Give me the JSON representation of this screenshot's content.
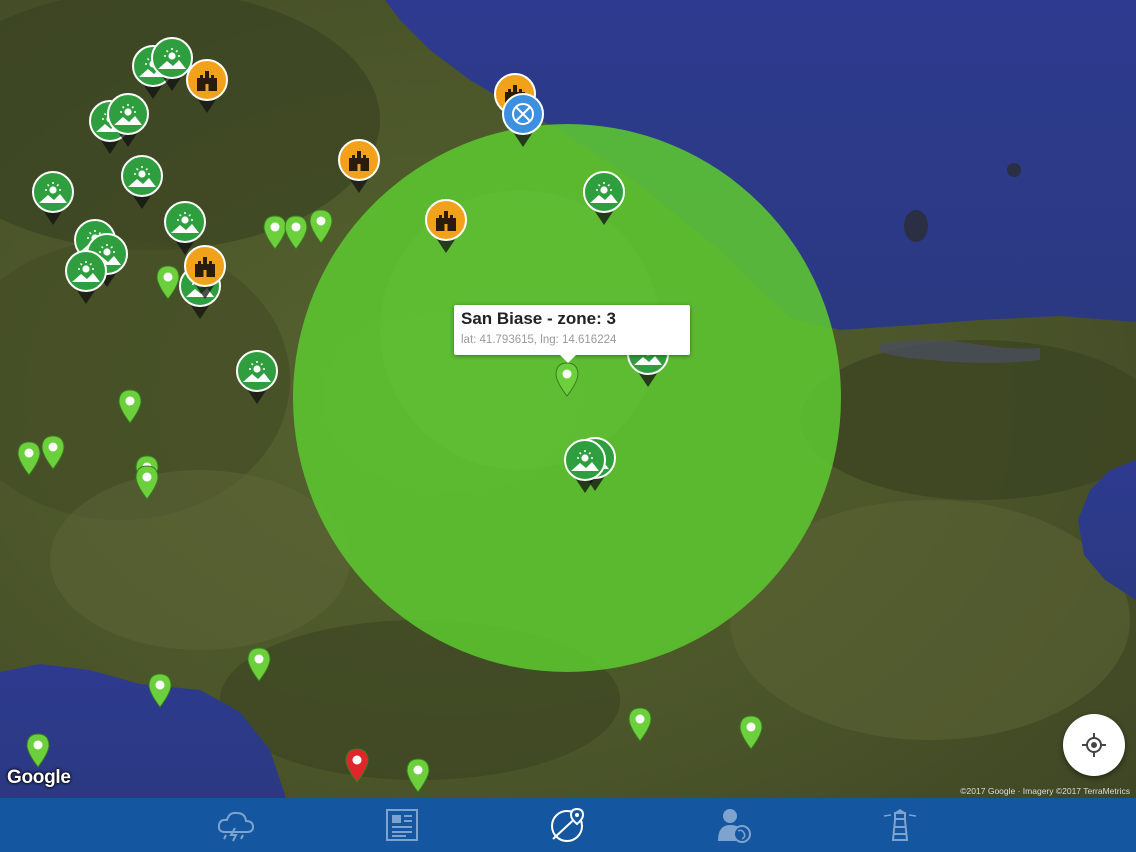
{
  "map": {
    "callout": {
      "title": "San Biase - zone: 3",
      "subtitle": "lat: 41.793615, lng: 14.616224"
    },
    "zone_circle_color": "#5cc630",
    "google_logo": "Google",
    "attribution": "©2017 Google · Imagery ©2017 TerraMetrics",
    "locate_button_icon": "crosshair-icon",
    "marker_colors": {
      "weather": "#2e9e3e",
      "castle": "#f2a21a",
      "poi": "#6ccf3c",
      "alert": "#e0262a",
      "drone": "#3d8fe0"
    }
  },
  "tabbar": {
    "tabs": [
      {
        "icon": "weather-storm-icon",
        "active": false
      },
      {
        "icon": "newspaper-icon",
        "active": false
      },
      {
        "icon": "map-pin-compass-icon",
        "active": true
      },
      {
        "icon": "user-globe-icon",
        "active": false
      },
      {
        "icon": "lighthouse-icon",
        "active": false
      }
    ]
  }
}
